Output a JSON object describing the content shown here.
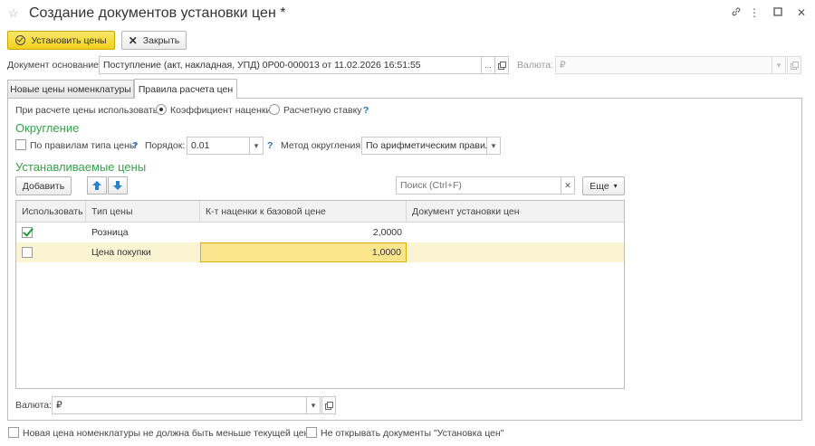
{
  "window": {
    "title": "Создание документов установки цен *"
  },
  "toolbar": {
    "set_prices_label": "Установить цены",
    "close_label": "Закрыть"
  },
  "header": {
    "basis_label": "Документ основание:",
    "basis_value": "Поступление (акт, накладная, УПД) 0Р00-000013 от 11.02.2026 16:51:55",
    "currency_label": "Валюта:",
    "currency_value": "₽"
  },
  "tabs": [
    {
      "label": "Новые цены номенклатуры",
      "active": false
    },
    {
      "label": "Правила расчета цен",
      "active": true
    }
  ],
  "rules": {
    "use_label": "При расчете цены использовать:",
    "option_markup": "Коэффициент наценки",
    "option_rate": "Расчетную ставку",
    "help": "?"
  },
  "rounding": {
    "section_title": "Округление",
    "by_price_type_label": "По правилам типа цены",
    "order_label": "Порядок:",
    "order_value": "0.01",
    "method_label": "Метод округления:",
    "method_value": "По арифметическим правилам"
  },
  "prices": {
    "section_title": "Устанавливаемые цены",
    "add_label": "Добавить",
    "search_placeholder": "Поиск (Ctrl+F)",
    "more_label": "Еще",
    "columns": [
      "Использовать",
      "Тип цены",
      "К-т наценки к базовой цене",
      "Документ установки цен"
    ],
    "rows": [
      {
        "use": true,
        "type": "Розница",
        "coef": "2,0000",
        "doc": ""
      },
      {
        "use": false,
        "type": "Цена покупки",
        "coef": "1,0000",
        "doc": ""
      }
    ]
  },
  "footer": {
    "currency_label": "Валюта:",
    "currency_value": "₽",
    "not_less_label": "Новая цена номенклатуры не должна быть меньше текущей цены",
    "no_open_label": "Не открывать документы \"Установка цен\""
  },
  "colors": {
    "primary_button": "#f2d11b",
    "section_title": "#3aa04a",
    "help": "#2a6fb6",
    "arrow": "#2a7fd0",
    "selected_row": "#fbf4d3"
  }
}
